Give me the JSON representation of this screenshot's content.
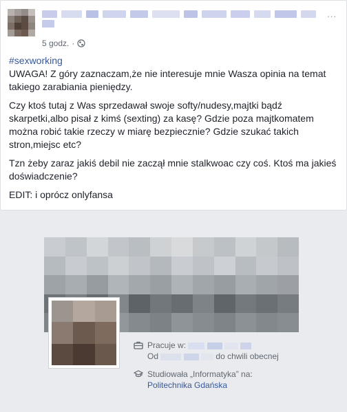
{
  "post": {
    "time": "5 godz.",
    "menu_label": "...",
    "hashtag": "#sexworking",
    "paragraphs": [
      "UWAGA! Z góry zaznaczam,że nie interesuje mnie Wasza opinia na temat takiego zarabiania pieniędzy.",
      "Czy ktoś tutaj z Was sprzedawał swoje softy/nudesy,majtki bądź skarpetki,albo pisał z kimś (sexting) za kasę? Gdzie poza majtkomatem można robić takie rzeczy w miarę bezpiecznie? Gdzie szukać takich stron,miejsc etc?",
      "Tzn żeby zaraz jakiś debil nie zaczął mnie stalkwoac czy coś. Ktoś ma jakieś doświadczenie?",
      "EDIT: i oprócz onlyfansa"
    ]
  },
  "profile_card": {
    "work_label": "Pracuje w:",
    "since_prefix": "Od",
    "since_suffix": "do chwili obecnej",
    "study_label": "Studiowała „Informatyka” na:",
    "school": "Politechnika Gdańska"
  },
  "icons": {
    "privacy": "globe-icon",
    "work": "briefcase-icon",
    "education": "graduation-cap-icon",
    "menu": "more-options-icon"
  },
  "colors": {
    "link": "#385898",
    "text": "#1d2129",
    "meta": "#616770",
    "background": "#e9ebee"
  }
}
